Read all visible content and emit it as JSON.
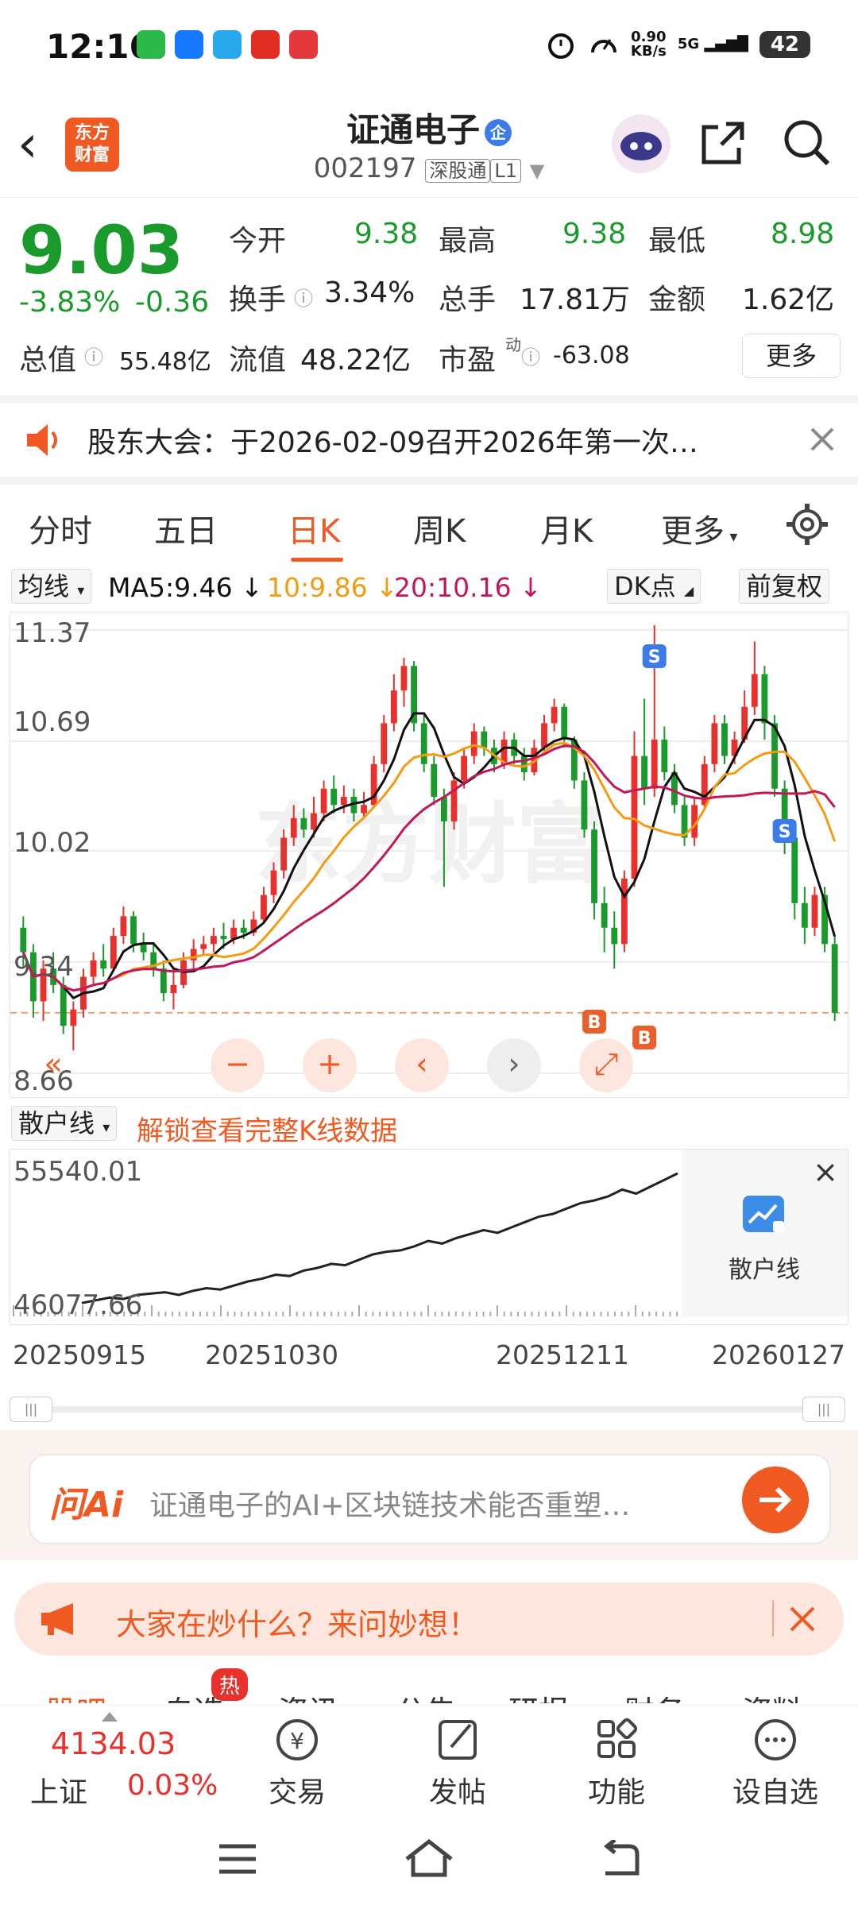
{
  "status": {
    "time": "12:16",
    "speed_top": "0.90",
    "speed_bottom": "KB/s",
    "network": "5G",
    "battery": "42"
  },
  "header": {
    "back": "‹",
    "logo_line1": "东方",
    "logo_line2": "财富",
    "stock_name": "证通电子",
    "badge": "企",
    "code": "002197",
    "tag1": "深股通",
    "tag2": "L1"
  },
  "quote": {
    "price": "9.03",
    "pct": "-3.83%",
    "change": "-0.36",
    "open_label": "今开",
    "open": "9.38",
    "high_label": "最高",
    "high": "9.38",
    "low_label": "最低",
    "low": "8.98",
    "turnover_label": "换手",
    "turnover": "3.34%",
    "volume_label": "总手",
    "volume": "17.81万",
    "amount_label": "金额",
    "amount": "1.62亿",
    "mcap_label": "总值",
    "mcap": "55.48亿",
    "float_label": "流值",
    "float": "48.22亿",
    "pe_label": "市盈",
    "pe_sup": "动",
    "pe": "-63.08",
    "more": "更多"
  },
  "notice": {
    "text": "股东大会：于2026-02-09召开2026年第一次…"
  },
  "tabs": [
    "分时",
    "五日",
    "日K",
    "周K",
    "月K",
    "更多"
  ],
  "ma": {
    "selector": "均线",
    "ma5": "MA5:9.46 ↓",
    "ma10": "10:9.86 ↓",
    "ma20": "20:10.16 ↓",
    "dk": "DK点",
    "fq": "前复权"
  },
  "chart_data": {
    "type": "candlestick",
    "ylim": [
      8.66,
      11.37
    ],
    "y_ticks": [
      "11.37",
      "10.69",
      "10.02",
      "9.34",
      "8.66"
    ],
    "watermark": "东方财富",
    "signals": [
      "S",
      "B",
      "S",
      "B"
    ],
    "candles": [
      [
        9.55,
        9.4,
        9.62,
        9.3
      ],
      [
        9.4,
        9.1,
        9.45,
        9.0
      ],
      [
        9.1,
        9.3,
        9.35,
        8.98
      ],
      [
        9.3,
        9.2,
        9.4,
        9.15
      ],
      [
        9.2,
        8.95,
        9.25,
        8.9
      ],
      [
        8.95,
        9.05,
        9.1,
        8.8
      ],
      [
        9.05,
        9.25,
        9.3,
        9.0
      ],
      [
        9.25,
        9.35,
        9.4,
        9.2
      ],
      [
        9.35,
        9.3,
        9.45,
        9.25
      ],
      [
        9.3,
        9.5,
        9.55,
        9.28
      ],
      [
        9.5,
        9.62,
        9.68,
        9.45
      ],
      [
        9.62,
        9.45,
        9.65,
        9.4
      ],
      [
        9.45,
        9.4,
        9.52,
        9.35
      ],
      [
        9.4,
        9.3,
        9.45,
        9.25
      ],
      [
        9.3,
        9.15,
        9.35,
        9.1
      ],
      [
        9.15,
        9.2,
        9.3,
        9.05
      ],
      [
        9.2,
        9.35,
        9.4,
        9.18
      ],
      [
        9.35,
        9.42,
        9.48,
        9.3
      ],
      [
        9.42,
        9.45,
        9.5,
        9.38
      ],
      [
        9.45,
        9.5,
        9.55,
        9.4
      ],
      [
        9.5,
        9.48,
        9.58,
        9.42
      ],
      [
        9.48,
        9.55,
        9.6,
        9.45
      ],
      [
        9.55,
        9.52,
        9.6,
        9.48
      ],
      [
        9.52,
        9.6,
        9.65,
        9.5
      ],
      [
        9.6,
        9.75,
        9.8,
        9.58
      ],
      [
        9.75,
        9.9,
        9.95,
        9.7
      ],
      [
        9.9,
        10.1,
        10.15,
        9.85
      ],
      [
        10.1,
        10.22,
        10.3,
        10.05
      ],
      [
        10.22,
        10.15,
        10.28,
        10.1
      ],
      [
        10.15,
        10.25,
        10.35,
        10.1
      ],
      [
        10.25,
        10.4,
        10.45,
        10.2
      ],
      [
        10.4,
        10.3,
        10.48,
        10.25
      ],
      [
        10.3,
        10.35,
        10.42,
        10.25
      ],
      [
        10.35,
        10.25,
        10.4,
        10.2
      ],
      [
        10.25,
        10.3,
        10.38,
        10.22
      ],
      [
        10.3,
        10.55,
        10.6,
        10.28
      ],
      [
        10.55,
        10.8,
        10.85,
        10.5
      ],
      [
        10.8,
        11.0,
        11.1,
        10.75
      ],
      [
        11.0,
        11.15,
        11.2,
        10.9
      ],
      [
        11.15,
        10.8,
        11.18,
        10.75
      ],
      [
        10.8,
        10.55,
        10.85,
        10.5
      ],
      [
        10.55,
        10.35,
        10.6,
        10.3
      ],
      [
        10.35,
        10.2,
        10.4,
        9.8
      ],
      [
        10.2,
        10.45,
        10.5,
        10.15
      ],
      [
        10.45,
        10.6,
        10.65,
        10.4
      ],
      [
        10.6,
        10.75,
        10.8,
        10.55
      ],
      [
        10.75,
        10.65,
        10.78,
        10.6
      ],
      [
        10.65,
        10.55,
        10.7,
        10.5
      ],
      [
        10.55,
        10.7,
        10.75,
        10.52
      ],
      [
        10.7,
        10.6,
        10.74,
        10.55
      ],
      [
        10.6,
        10.5,
        10.65,
        10.45
      ],
      [
        10.5,
        10.65,
        10.7,
        10.48
      ],
      [
        10.65,
        10.8,
        10.85,
        10.62
      ],
      [
        10.8,
        10.9,
        10.95,
        10.75
      ],
      [
        10.9,
        10.7,
        10.92,
        10.65
      ],
      [
        10.7,
        10.45,
        10.72,
        10.4
      ],
      [
        10.45,
        10.15,
        10.5,
        10.1
      ],
      [
        10.15,
        9.7,
        10.2,
        9.6
      ],
      [
        9.7,
        9.55,
        9.8,
        9.4
      ],
      [
        9.55,
        9.45,
        9.65,
        9.3
      ],
      [
        9.45,
        9.85,
        9.9,
        9.4
      ],
      [
        9.85,
        10.6,
        10.75,
        9.8
      ],
      [
        10.6,
        10.4,
        10.95,
        10.3
      ],
      [
        10.4,
        10.7,
        11.4,
        10.35
      ],
      [
        10.7,
        10.5,
        10.78,
        10.45
      ],
      [
        10.5,
        10.3,
        10.55,
        10.25
      ],
      [
        10.3,
        10.1,
        10.35,
        10.05
      ],
      [
        10.1,
        10.3,
        10.35,
        10.05
      ],
      [
        10.3,
        10.55,
        10.6,
        10.28
      ],
      [
        10.55,
        10.8,
        10.85,
        10.5
      ],
      [
        10.8,
        10.6,
        10.85,
        10.55
      ],
      [
        10.6,
        10.7,
        10.75,
        10.55
      ],
      [
        10.7,
        10.9,
        11.0,
        10.68
      ],
      [
        10.9,
        11.1,
        11.3,
        10.85
      ],
      [
        11.1,
        10.8,
        11.15,
        10.7
      ],
      [
        10.8,
        10.4,
        10.85,
        10.35
      ],
      [
        10.4,
        10.1,
        10.45,
        10.0
      ],
      [
        10.1,
        9.7,
        10.15,
        9.6
      ],
      [
        9.7,
        9.55,
        9.8,
        9.45
      ],
      [
        9.55,
        9.75,
        9.8,
        9.5
      ],
      [
        9.75,
        9.45,
        9.8,
        9.4
      ],
      [
        9.45,
        9.03,
        9.5,
        8.98
      ]
    ]
  },
  "nav_controls": [
    "«",
    "−",
    "+",
    "‹",
    "›",
    "⤢"
  ],
  "sanhu": {
    "selector": "散户线",
    "unlock": "解锁查看完整K线数据",
    "ymax": "55540.01",
    "ymin": "46077.66",
    "close": "×",
    "icon_label": "散户线"
  },
  "dates": [
    "20250915",
    "20251030",
    "20251211",
    "20260127"
  ],
  "ai": {
    "logo": "问Ai",
    "placeholder": "证通电子的AI+区块链技术能否重塑…"
  },
  "banner": {
    "text": "大家在炒什么？来问妙想！"
  },
  "subtabs": {
    "items": [
      "股吧",
      "自选",
      "资讯",
      "公告",
      "研报",
      "财务",
      "资料"
    ],
    "hot": "热"
  },
  "bottom": {
    "index_value": "4134.03",
    "index_name": "上证",
    "index_pct": "0.03%",
    "trade": "交易",
    "post": "发帖",
    "func": "功能",
    "watch": "设自选"
  },
  "colors": {
    "up": "#e8302c",
    "down": "#1a9a2b",
    "accent": "#f05a22",
    "ma5": "#111111",
    "ma10": "#f39c12",
    "ma20": "#c2185b"
  }
}
